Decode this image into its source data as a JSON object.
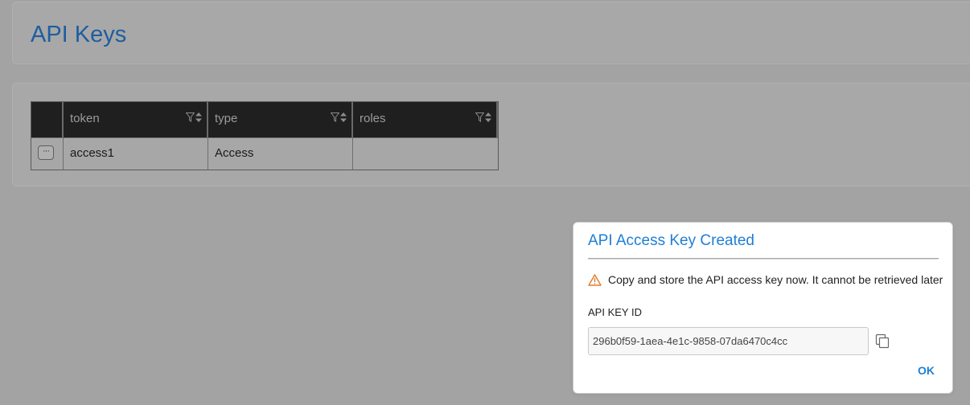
{
  "page": {
    "title": "API Keys"
  },
  "grid": {
    "columns": [
      {
        "label": "token"
      },
      {
        "label": "type"
      },
      {
        "label": "roles"
      }
    ],
    "rows": [
      {
        "more_label": "···",
        "token": "access1",
        "type": "Access",
        "roles": ""
      }
    ]
  },
  "dialog": {
    "title": "API Access Key Created",
    "warning": "Copy and store the API access key now. It cannot be retrieved later",
    "key_label": "API KEY ID",
    "key_value": "296b0f59-1aea-4e1c-9858-07da6470c4cc",
    "ok_label": "OK"
  },
  "icons": {
    "filter": "filter-icon",
    "sort": "sort-icon",
    "warning": "warning-icon",
    "copy": "copy-icon"
  },
  "colors": {
    "title_blue": "#1e5ea0",
    "accent_blue": "#1e7fd6",
    "warning_orange": "#e07b2a",
    "header_bg": "#1f1f1f",
    "overlay_bg": "#a3a3a3"
  }
}
